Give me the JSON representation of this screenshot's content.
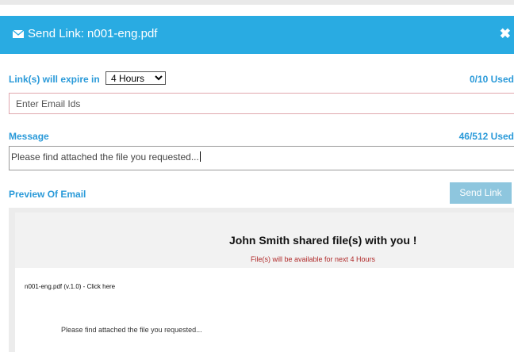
{
  "dialog": {
    "title": "Send Link: n001-eng.pdf",
    "close_label": "✖",
    "header_color": "#29abe2"
  },
  "expiry": {
    "label": "Link(s) will expire in",
    "selected": "4 Hours",
    "usage": "0/10 Used"
  },
  "email": {
    "placeholder": "Enter Email Ids",
    "value": ""
  },
  "message": {
    "label": "Message",
    "usage": "46/512 Used",
    "value": "Please find attached the file you requested..."
  },
  "preview": {
    "label": "Preview Of Email",
    "heading": "John Smith shared file(s) with you !",
    "availability": "File(s) will be available for next 4 Hours",
    "file_link": "n001-eng.pdf (v.1.0) - Click here",
    "message": "Please find attached the file you requested..."
  },
  "actions": {
    "send_label": "Send Link"
  },
  "icons": {
    "title_icon": "envelope-icon",
    "close_icon": "close-icon"
  }
}
